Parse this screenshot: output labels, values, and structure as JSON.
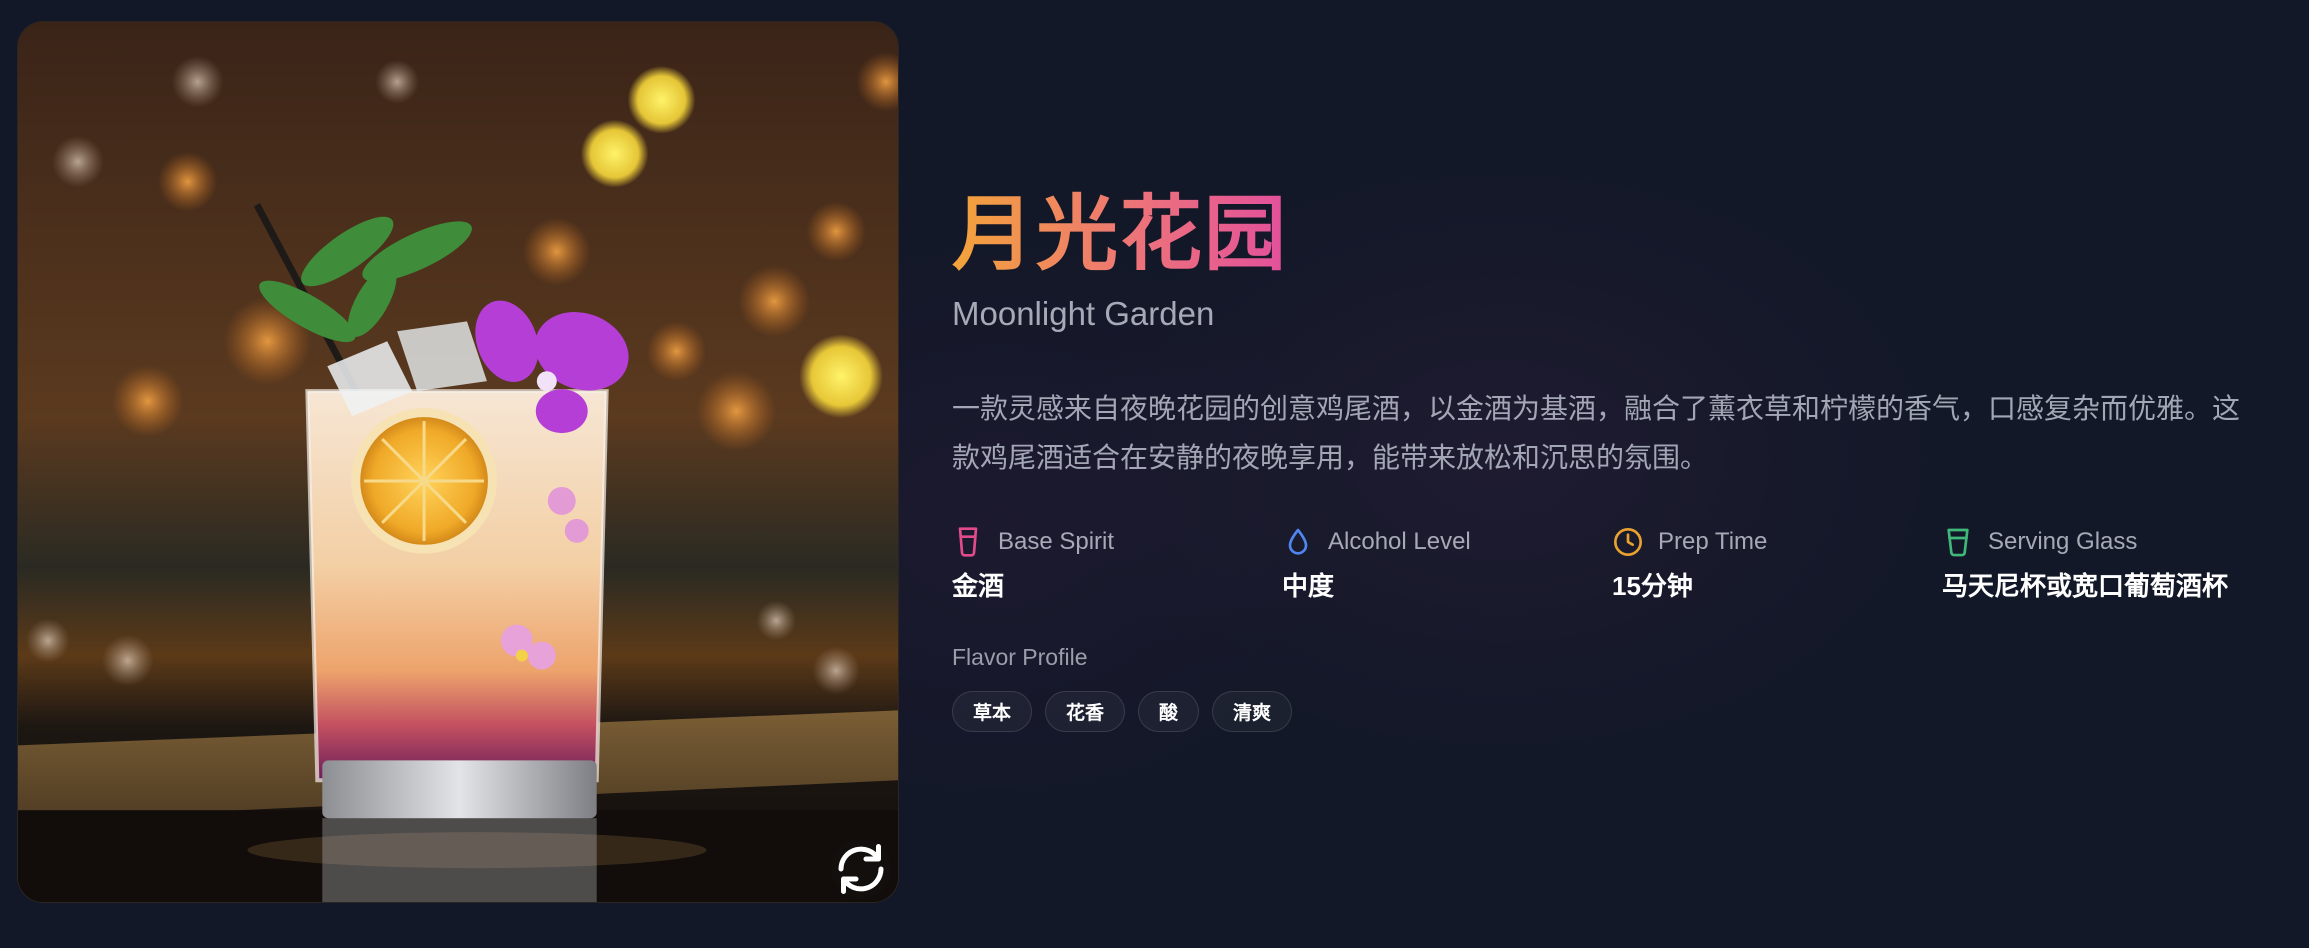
{
  "cocktail": {
    "name_zh": "月光花园",
    "name_en": "Moonlight Garden",
    "description": "一款灵感来自夜晚花园的创意鸡尾酒，以金酒为基酒，融合了薰衣草和柠檬的香气，口感复杂而优雅。这款鸡尾酒适合在安静的夜晚享用，能带来放松和沉思的氛围。"
  },
  "photo": {
    "icon": "cocktail-photo",
    "refresh_icon": "refresh-icon"
  },
  "stats": [
    {
      "label": "Base Spirit",
      "value": "金酒",
      "icon": "glass-icon",
      "color": "#e24b8b"
    },
    {
      "label": "Alcohol Level",
      "value": "中度",
      "icon": "droplet-icon",
      "color": "#4f86f0"
    },
    {
      "label": "Prep Time",
      "value": "15分钟",
      "icon": "clock-icon",
      "color": "#e8a230"
    },
    {
      "label": "Serving Glass",
      "value": "马天尼杯或宽口葡萄酒杯",
      "icon": "cup-icon",
      "color": "#3fb87a"
    }
  ],
  "flavor": {
    "label": "Flavor Profile",
    "tags": [
      "草本",
      "花香",
      "酸",
      "清爽"
    ]
  },
  "colors": {
    "background": "#131828",
    "title_gradient_start": "#f3a43a",
    "title_gradient_end": "#e2509c"
  }
}
